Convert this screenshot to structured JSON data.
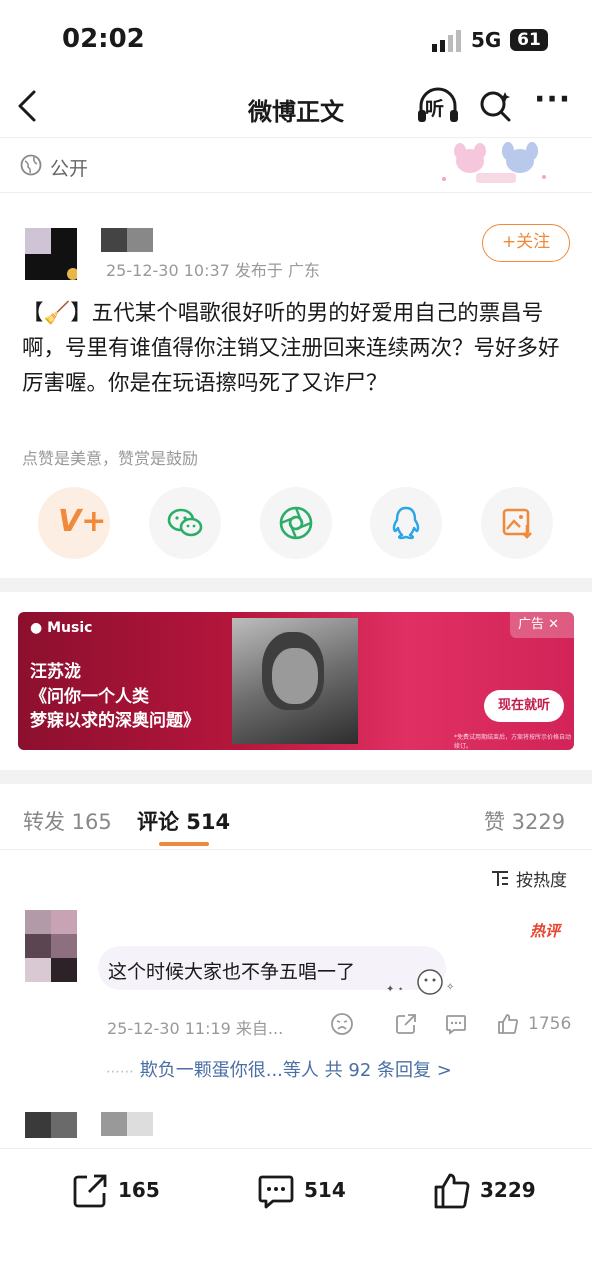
{
  "status_bar": {
    "time": "02:02",
    "network": "5G",
    "battery": "61"
  },
  "nav": {
    "title": "微博正文",
    "listen_label": "听"
  },
  "visibility": {
    "label": "公开"
  },
  "post": {
    "meta": "25-12-30 10:37  发布于 广东",
    "follow_label": "+关注",
    "text": "【🧹】五代某个唱歌很好听的男的好爱用自己的票昌号啊，号里有谁值得你注销又注册回来连续两次？号好多好厉害喔。你是在玩语擦吗死了又诈尸？",
    "praise_hint": "点赞是美意，赞赏是鼓励"
  },
  "share_actions": [
    {
      "name": "reward",
      "icon": "v-plus-icon"
    },
    {
      "name": "wechat",
      "icon": "wechat-icon"
    },
    {
      "name": "moments",
      "icon": "moments-icon"
    },
    {
      "name": "qq",
      "icon": "qq-icon"
    },
    {
      "name": "save-image",
      "icon": "image-download-icon"
    }
  ],
  "ad": {
    "brand": "Music",
    "artist": "汪苏泷",
    "album_line1": "《问你一个人类",
    "album_line2": "梦寐以求的深奥问题》",
    "tag": "广告",
    "cta": "现在就听",
    "fine_print": "*免费试用期结束后，方案将按所示价格自动续订。"
  },
  "tabs": {
    "repost": "转发 165",
    "comments": "评论 514",
    "likes": "赞 3229"
  },
  "sort_label": "按热度",
  "comment": {
    "hot_badge": "热评",
    "text": "这个时候大家也不争五唱一了",
    "time": "25-12-30 11:19  来自...",
    "likes": "1756",
    "reply_dots": "⋯⋯",
    "reply_names": "欺负一颗蛋你很...等人",
    "reply_count": "共 92 条回复 >"
  },
  "bottom_bar": {
    "reposts": "165",
    "comments": "514",
    "likes": "3229"
  },
  "colors": {
    "accent": "#f08a3a",
    "link": "#4a6fa5",
    "ad_bg": "#b6163c"
  }
}
